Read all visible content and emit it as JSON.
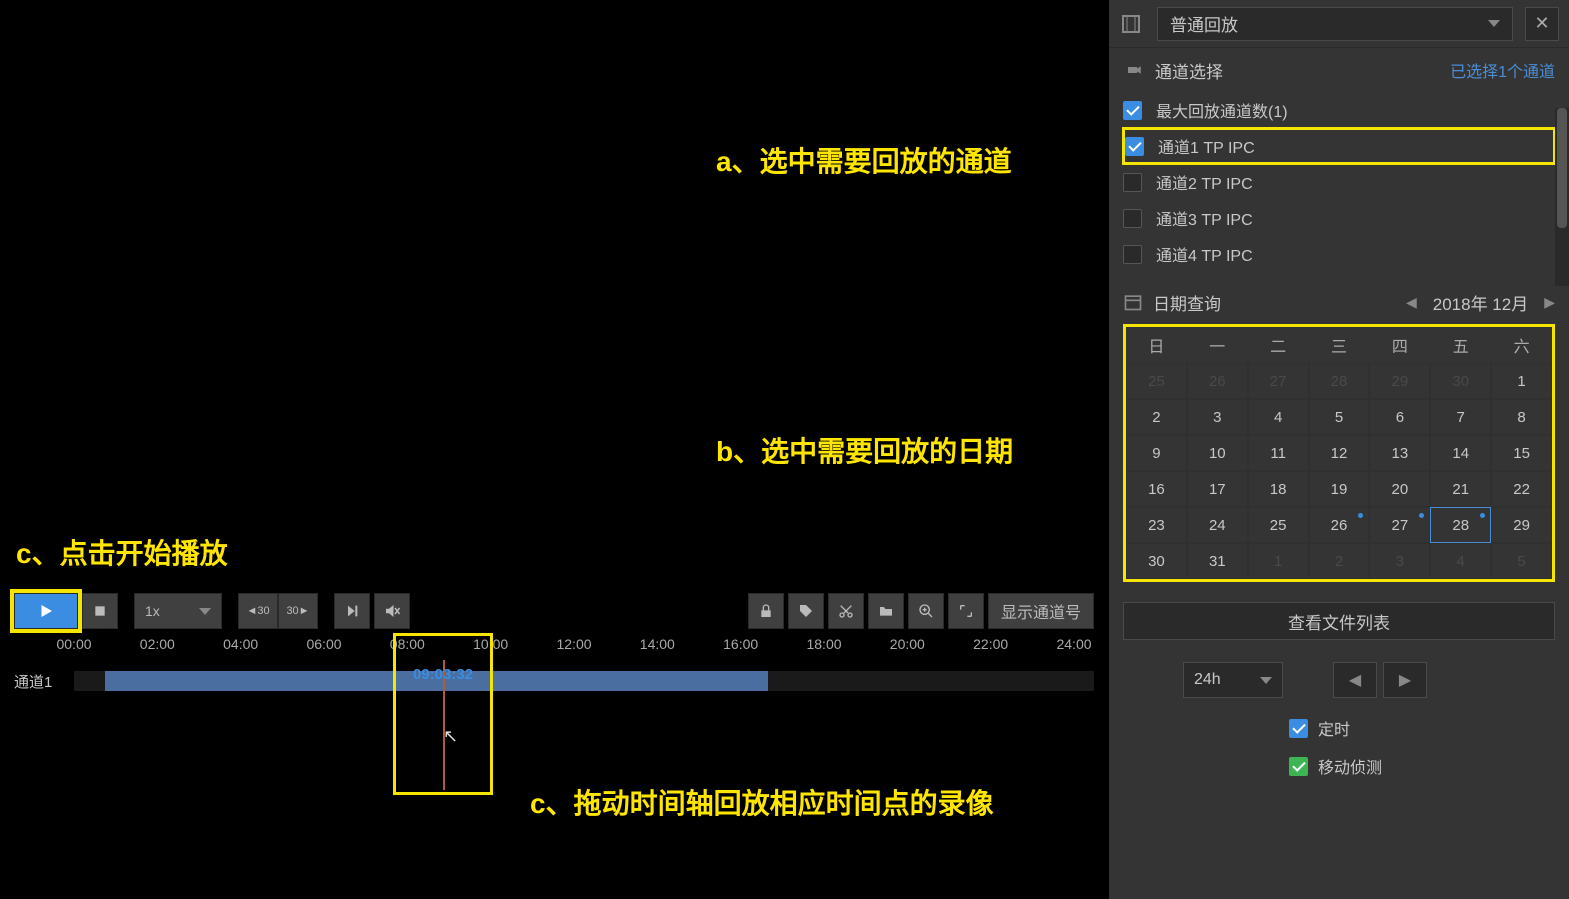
{
  "header": {
    "mode_label": "普通回放",
    "close": "✕"
  },
  "channel_section": {
    "title": "通道选择",
    "selected_link": "已选择1个通道",
    "max_label": "最大回放通道数(1)",
    "channels": [
      {
        "label": "通道1 TP IPC",
        "checked": true
      },
      {
        "label": "通道2 TP IPC",
        "checked": false
      },
      {
        "label": "通道3 TP IPC",
        "checked": false
      },
      {
        "label": "通道4 TP IPC",
        "checked": false
      }
    ]
  },
  "date_section": {
    "title": "日期查询",
    "current": "2018年 12月",
    "weekdays": [
      "日",
      "一",
      "二",
      "三",
      "四",
      "五",
      "六"
    ],
    "rows": [
      [
        {
          "d": "25",
          "dim": true
        },
        {
          "d": "26",
          "dim": true
        },
        {
          "d": "27",
          "dim": true
        },
        {
          "d": "28",
          "dim": true
        },
        {
          "d": "29",
          "dim": true
        },
        {
          "d": "30",
          "dim": true
        },
        {
          "d": "1"
        }
      ],
      [
        {
          "d": "2"
        },
        {
          "d": "3"
        },
        {
          "d": "4"
        },
        {
          "d": "5"
        },
        {
          "d": "6"
        },
        {
          "d": "7"
        },
        {
          "d": "8"
        }
      ],
      [
        {
          "d": "9"
        },
        {
          "d": "10"
        },
        {
          "d": "11"
        },
        {
          "d": "12"
        },
        {
          "d": "13"
        },
        {
          "d": "14"
        },
        {
          "d": "15"
        }
      ],
      [
        {
          "d": "16"
        },
        {
          "d": "17"
        },
        {
          "d": "18"
        },
        {
          "d": "19"
        },
        {
          "d": "20"
        },
        {
          "d": "21"
        },
        {
          "d": "22"
        }
      ],
      [
        {
          "d": "23"
        },
        {
          "d": "24"
        },
        {
          "d": "25"
        },
        {
          "d": "26",
          "dot": true
        },
        {
          "d": "27",
          "dot": true
        },
        {
          "d": "28",
          "dot": true,
          "sel": true
        },
        {
          "d": "29"
        }
      ],
      [
        {
          "d": "30"
        },
        {
          "d": "31"
        },
        {
          "d": "1",
          "dim": true
        },
        {
          "d": "2",
          "dim": true
        },
        {
          "d": "3",
          "dim": true
        },
        {
          "d": "4",
          "dim": true
        },
        {
          "d": "5",
          "dim": true
        }
      ]
    ],
    "view_files": "查看文件列表",
    "range": "24h",
    "filter_timed": "定时",
    "filter_motion": "移动侦测"
  },
  "toolbar": {
    "speed": "1x",
    "back30": "◄30",
    "fwd30": "30►",
    "show_channel": "显示通道号"
  },
  "timeline": {
    "ticks": [
      "00:00",
      "02:00",
      "04:00",
      "06:00",
      "08:00",
      "10:00",
      "12:00",
      "14:00",
      "16:00",
      "18:00",
      "20:00",
      "22:00",
      "24:00"
    ],
    "channel_label": "通道1",
    "playhead_time": "09:03:32"
  },
  "annotations": {
    "a": "a、选中需要回放的通道",
    "b": "b、选中需要回放的日期",
    "c_play": "c、点击开始播放",
    "c_drag": "c、拖动时间轴回放相应时间点的录像"
  }
}
